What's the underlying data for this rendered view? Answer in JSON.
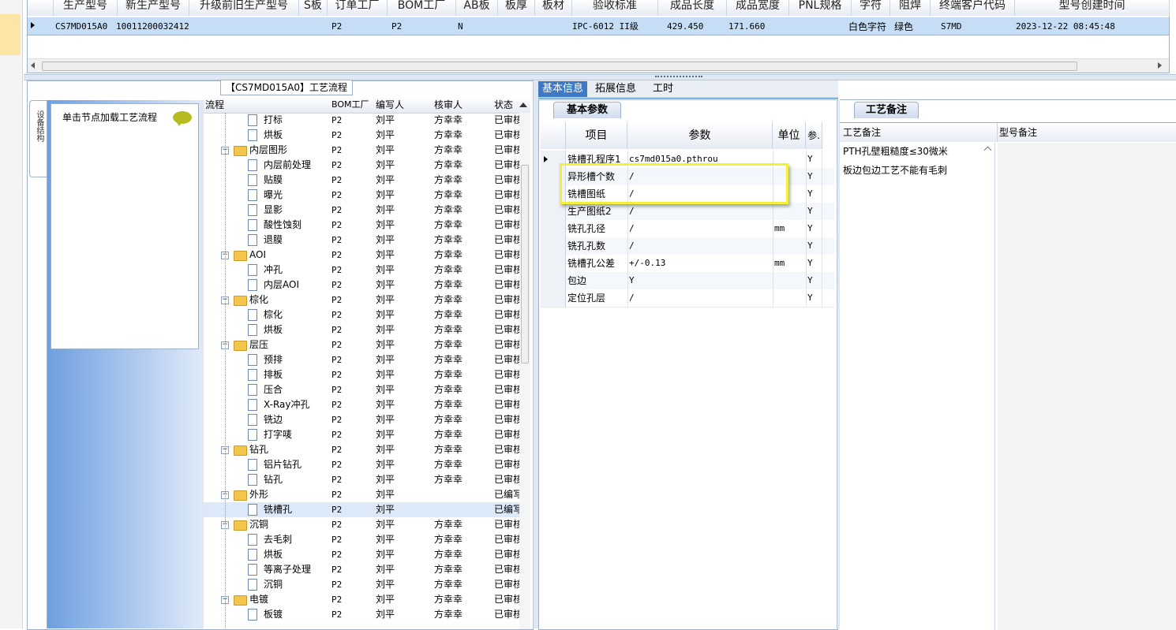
{
  "top_grid": {
    "headers": [
      "生产型号",
      "新生产型号",
      "升级前旧生产型号",
      "S板",
      "订单工厂",
      "BOM工厂",
      "AB板",
      "板厚",
      "板材",
      "验收标准",
      "成品长度",
      "成品宽度",
      "PNL规格",
      "字符",
      "阻焊",
      "终端客户代码",
      "型号创建时间"
    ],
    "row": {
      "model": "CS7MD015A0",
      "new_model": "10011200032412",
      "old_model": "",
      "s_board": "",
      "order_factory": "P2",
      "bom_factory": "P2",
      "ab_board": "N",
      "thickness": "",
      "material": "",
      "standard": "IPC-6012 II级",
      "length": "429.450",
      "width": "171.660",
      "pnl": "",
      "char": "白色字符",
      "solder": "绿色",
      "customer": "S7MD",
      "created": "2023-12-22 08:45:48"
    }
  },
  "left_panel": {
    "title": "【CS7MD015A0】工艺流程",
    "side_tab": "设备结构",
    "hint": "单击节点加载工艺流程",
    "tree_headers": [
      "流程",
      "BOM工厂",
      "编写人",
      "核审人",
      "状态"
    ],
    "rows": [
      {
        "name": "打标",
        "level": 1,
        "bom": "P2",
        "writer": "刘平",
        "reviewer": "方幸幸",
        "status": "已审核"
      },
      {
        "name": "烘板",
        "level": 1,
        "bom": "P2",
        "writer": "刘平",
        "reviewer": "方幸幸",
        "status": "已审核"
      },
      {
        "name": "内层图形",
        "level": 0,
        "bom": "P2",
        "writer": "刘平",
        "reviewer": "方幸幸",
        "status": "已审核"
      },
      {
        "name": "内层前处理",
        "level": 1,
        "bom": "P2",
        "writer": "刘平",
        "reviewer": "方幸幸",
        "status": "已审核"
      },
      {
        "name": "贴膜",
        "level": 1,
        "bom": "P2",
        "writer": "刘平",
        "reviewer": "方幸幸",
        "status": "已审核"
      },
      {
        "name": "曝光",
        "level": 1,
        "bom": "P2",
        "writer": "刘平",
        "reviewer": "方幸幸",
        "status": "已审核"
      },
      {
        "name": "显影",
        "level": 1,
        "bom": "P2",
        "writer": "刘平",
        "reviewer": "方幸幸",
        "status": "已审核"
      },
      {
        "name": "酸性蚀刻",
        "level": 1,
        "bom": "P2",
        "writer": "刘平",
        "reviewer": "方幸幸",
        "status": "已审核"
      },
      {
        "name": "退膜",
        "level": 1,
        "bom": "P2",
        "writer": "刘平",
        "reviewer": "方幸幸",
        "status": "已审核"
      },
      {
        "name": "AOI",
        "level": 0,
        "bom": "P2",
        "writer": "刘平",
        "reviewer": "方幸幸",
        "status": "已审核"
      },
      {
        "name": "冲孔",
        "level": 1,
        "bom": "P2",
        "writer": "刘平",
        "reviewer": "方幸幸",
        "status": "已审核"
      },
      {
        "name": "内层AOI",
        "level": 1,
        "bom": "P2",
        "writer": "刘平",
        "reviewer": "方幸幸",
        "status": "已审核"
      },
      {
        "name": "棕化",
        "level": 0,
        "bom": "P2",
        "writer": "刘平",
        "reviewer": "方幸幸",
        "status": "已审核"
      },
      {
        "name": "棕化",
        "level": 1,
        "bom": "P2",
        "writer": "刘平",
        "reviewer": "方幸幸",
        "status": "已审核"
      },
      {
        "name": "烘板",
        "level": 1,
        "bom": "P2",
        "writer": "刘平",
        "reviewer": "方幸幸",
        "status": "已审核"
      },
      {
        "name": "层压",
        "level": 0,
        "bom": "P2",
        "writer": "刘平",
        "reviewer": "方幸幸",
        "status": "已审核"
      },
      {
        "name": "预排",
        "level": 1,
        "bom": "P2",
        "writer": "刘平",
        "reviewer": "方幸幸",
        "status": "已审核"
      },
      {
        "name": "排板",
        "level": 1,
        "bom": "P2",
        "writer": "刘平",
        "reviewer": "方幸幸",
        "status": "已审核"
      },
      {
        "name": "压合",
        "level": 1,
        "bom": "P2",
        "writer": "刘平",
        "reviewer": "方幸幸",
        "status": "已审核"
      },
      {
        "name": "X-Ray冲孔",
        "level": 1,
        "bom": "P2",
        "writer": "刘平",
        "reviewer": "方幸幸",
        "status": "已审核"
      },
      {
        "name": "铣边",
        "level": 1,
        "bom": "P2",
        "writer": "刘平",
        "reviewer": "方幸幸",
        "status": "已审核"
      },
      {
        "name": "打字唛",
        "level": 1,
        "bom": "P2",
        "writer": "刘平",
        "reviewer": "方幸幸",
        "status": "已审核"
      },
      {
        "name": "钻孔",
        "level": 0,
        "bom": "P2",
        "writer": "刘平",
        "reviewer": "方幸幸",
        "status": "已审核"
      },
      {
        "name": "铝片钻孔",
        "level": 1,
        "bom": "P2",
        "writer": "刘平",
        "reviewer": "方幸幸",
        "status": "已审核"
      },
      {
        "name": "钻孔",
        "level": 1,
        "bom": "P2",
        "writer": "刘平",
        "reviewer": "方幸幸",
        "status": "已审核"
      },
      {
        "name": "外形",
        "level": 0,
        "bom": "P2",
        "writer": "刘平",
        "reviewer": "",
        "status": "已编写"
      },
      {
        "name": "铣槽孔",
        "level": 1,
        "bom": "P2",
        "writer": "刘平",
        "reviewer": "",
        "status": "已编写",
        "selected": true
      },
      {
        "name": "沉铜",
        "level": 0,
        "bom": "P2",
        "writer": "刘平",
        "reviewer": "方幸幸",
        "status": "已审核"
      },
      {
        "name": "去毛刺",
        "level": 1,
        "bom": "P2",
        "writer": "刘平",
        "reviewer": "方幸幸",
        "status": "已审核"
      },
      {
        "name": "烘板",
        "level": 1,
        "bom": "P2",
        "writer": "刘平",
        "reviewer": "方幸幸",
        "status": "已审核"
      },
      {
        "name": "等离子处理",
        "level": 1,
        "bom": "P2",
        "writer": "刘平",
        "reviewer": "方幸幸",
        "status": "已审核"
      },
      {
        "name": "沉铜",
        "level": 1,
        "bom": "P2",
        "writer": "刘平",
        "reviewer": "方幸幸",
        "status": "已审核"
      },
      {
        "name": "电镀",
        "level": 0,
        "bom": "P2",
        "writer": "刘平",
        "reviewer": "方幸幸",
        "status": "已审核"
      },
      {
        "name": "板镀",
        "level": 1,
        "bom": "P2",
        "writer": "刘平",
        "reviewer": "方幸幸",
        "status": "已审核"
      }
    ]
  },
  "middle_panel": {
    "tabs": [
      "基本信息",
      "拓展信息",
      "工时"
    ],
    "sub_tab": "基本参数",
    "headers": [
      "项目",
      "参数",
      "单位",
      "参数"
    ],
    "header_short": "参.",
    "rows": [
      {
        "item": "铣槽孔程序1",
        "param": "cs7md015a0.pthrou",
        "unit": "",
        "flag": "Y"
      },
      {
        "item": "异形槽个数",
        "param": "/",
        "unit": "",
        "flag": "Y"
      },
      {
        "item": "铣槽图纸",
        "param": "/",
        "unit": "",
        "flag": "Y"
      },
      {
        "item": "生产图纸2",
        "param": "/",
        "unit": "",
        "flag": "Y"
      },
      {
        "item": "铣孔孔径",
        "param": "/",
        "unit": "mm",
        "flag": "Y"
      },
      {
        "item": "铣孔孔数",
        "param": "/",
        "unit": "",
        "flag": "Y"
      },
      {
        "item": "铣槽孔公差",
        "param": "+/-0.13",
        "unit": "mm",
        "flag": "Y"
      },
      {
        "item": "包边",
        "param": "Y",
        "unit": "",
        "flag": "Y"
      },
      {
        "item": "定位孔层",
        "param": "/",
        "unit": "",
        "flag": "Y"
      }
    ],
    "highlight_color": "#f2f03a"
  },
  "right_panel": {
    "tab": "工艺备注",
    "headers": [
      "工艺备注",
      "型号备注"
    ],
    "notes": [
      "PTH孔壁粗糙度≤30微米",
      "板边包边工艺不能有毛刺"
    ]
  },
  "colors": {
    "selected_row": "#c6ddf6",
    "tab_active": "#3f78c3",
    "blue_gradient_start": "#6e9fe0",
    "blue_gradient_end": "#dfeafa"
  }
}
